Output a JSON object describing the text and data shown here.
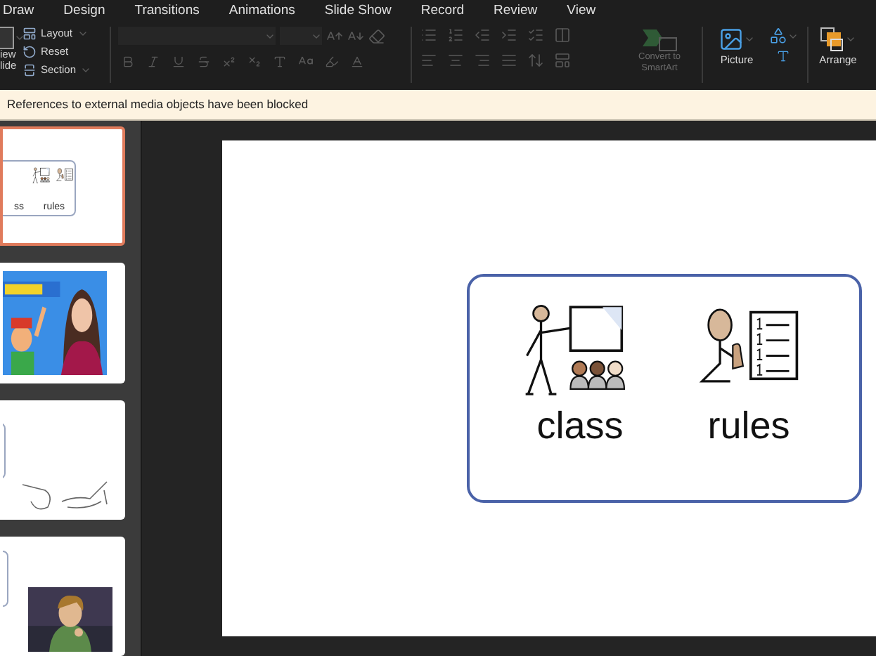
{
  "menu": [
    "Draw",
    "Design",
    "Transitions",
    "Animations",
    "Slide Show",
    "Record",
    "Review",
    "View"
  ],
  "ribbon": {
    "new_slide": [
      "iew",
      "lide"
    ],
    "slide_buttons": [
      "Layout",
      "Reset",
      "Section"
    ],
    "convert": "Convert to SmartArt",
    "picture": "Picture",
    "arrange": "Arrange"
  },
  "notice": "References to external media objects have been blocked",
  "thumbnails": [
    {
      "kind": "symbols",
      "selected": true,
      "labels": [
        "ss",
        "rules"
      ]
    },
    {
      "kind": "picture",
      "selected": false
    },
    {
      "kind": "sketch",
      "selected": false
    },
    {
      "kind": "card-picture",
      "selected": false
    }
  ],
  "slide": {
    "symbols": [
      {
        "kind": "class",
        "label": "class"
      },
      {
        "kind": "rules",
        "label": "rules"
      }
    ]
  }
}
